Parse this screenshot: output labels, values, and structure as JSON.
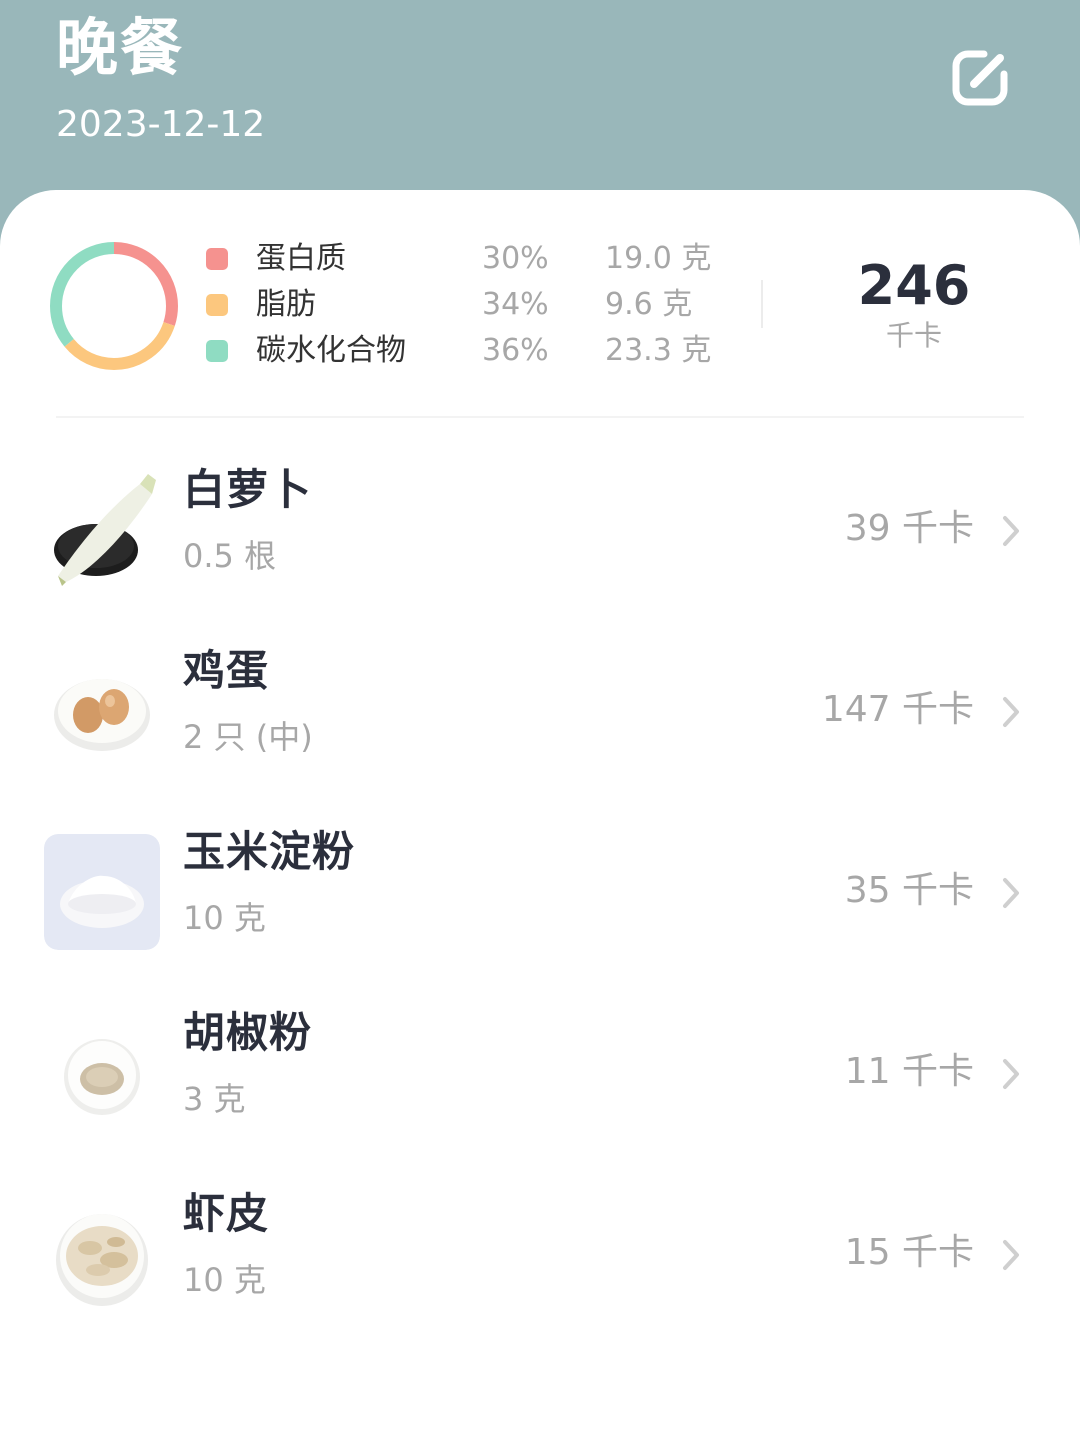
{
  "header": {
    "title": "晚餐",
    "date": "2023-12-12",
    "background_color": "#99b7ba",
    "edit_icon": "edit-square-icon"
  },
  "summary": {
    "macros": [
      {
        "name": "蛋白质",
        "percent": "30%",
        "grams": "19.0 克",
        "color": "#f5928f"
      },
      {
        "name": "脂肪",
        "percent": "34%",
        "grams": "9.6 克",
        "color": "#fcc77e"
      },
      {
        "name": "碳水化合物",
        "percent": "36%",
        "grams": "23.3 克",
        "color": "#8fdcc2"
      }
    ],
    "total_value": "246",
    "total_unit": "千卡"
  },
  "foods": [
    {
      "name": "白萝卜",
      "amount": "0.5 根",
      "calories": "39 千卡",
      "icon": "white-radish-image"
    },
    {
      "name": "鸡蛋",
      "amount": "2 只 (中)",
      "calories": "147 千卡",
      "icon": "eggs-image"
    },
    {
      "name": "玉米淀粉",
      "amount": "10 克",
      "calories": "35 千卡",
      "icon": "corn-starch-image"
    },
    {
      "name": "胡椒粉",
      "amount": "3 克",
      "calories": "11 千卡",
      "icon": "pepper-powder-image"
    },
    {
      "name": "虾皮",
      "amount": "10 克",
      "calories": "15 千卡",
      "icon": "dried-shrimp-image"
    }
  ]
}
